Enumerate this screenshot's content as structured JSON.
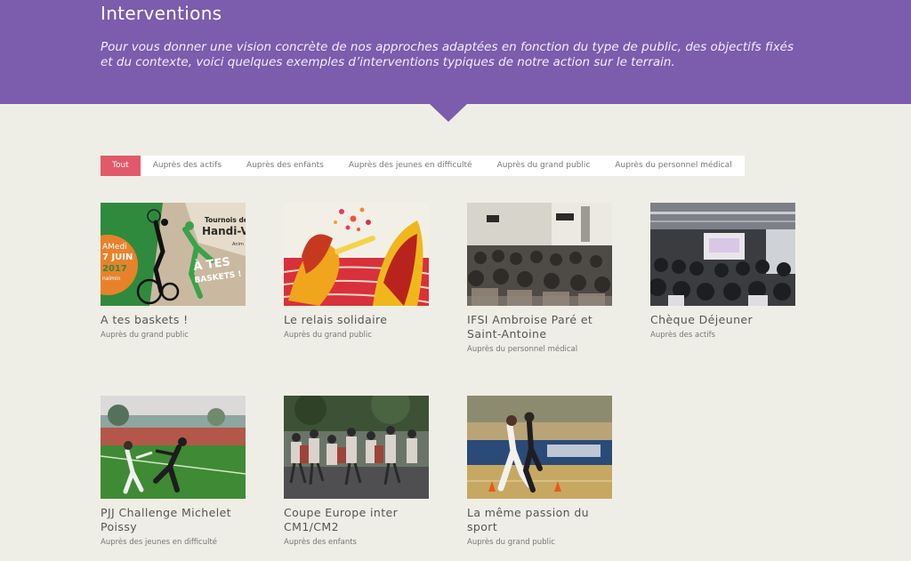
{
  "header": {
    "title": "Interventions",
    "intro": "Pour vous donner une vision concrète de nos approches adaptées en fonction du type de public, des objectifs fixés et du contexte, voici quelques exemples d’interventions typiques de notre action sur le terrain."
  },
  "filters": [
    {
      "label": "Tout",
      "active": true
    },
    {
      "label": "Auprès des actifs"
    },
    {
      "label": "Auprès des enfants"
    },
    {
      "label": "Auprès des jeunes en difficulté"
    },
    {
      "label": "Auprès du grand public"
    },
    {
      "label": "Auprès du personnel médical"
    }
  ],
  "poster": {
    "line1": "Tournois de Ba",
    "line2": "Handi-Va",
    "line3": "Anim",
    "date1": "AMedi",
    "date2": "7 JUIN",
    "year": "2017",
    "place": "naimin",
    "slogan1": "À TES",
    "slogan2": "BASKETS !"
  },
  "cards": [
    {
      "title": "A tes baskets !",
      "tag": "Auprès du grand public"
    },
    {
      "title": "Le relais solidaire",
      "tag": "Auprès du grand public"
    },
    {
      "title": "IFSI Ambroise Paré et Saint-Antoine",
      "tag": "Auprès du personnel médical"
    },
    {
      "title": "Chèque Déjeuner",
      "tag": "Auprès des actifs"
    },
    {
      "title": "PJJ Challenge Michelet Poissy",
      "tag": "Auprès des jeunes en difficulté"
    },
    {
      "title": "Coupe Europe inter CM1/CM2",
      "tag": "Auprès des enfants"
    },
    {
      "title": "La même passion du sport",
      "tag": "Auprès du grand public"
    }
  ],
  "colors": {
    "header_bg": "#7b5cad",
    "page_bg": "#efeee6",
    "active_filter": "#e2596a"
  }
}
